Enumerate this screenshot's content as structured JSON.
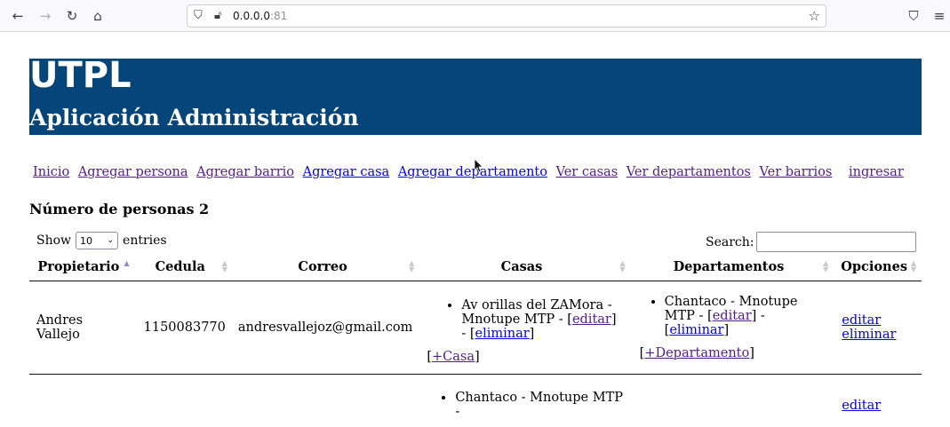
{
  "browser": {
    "url": "0.0.0.0",
    "port": ":81"
  },
  "header": {
    "logo": "UTPL",
    "title": "Aplicación Administración"
  },
  "menu": [
    {
      "label": "Inicio"
    },
    {
      "label": "Agregar persona"
    },
    {
      "label": "Agregar barrio"
    },
    {
      "label": "Agregar casa"
    },
    {
      "label": "Agregar departamento"
    },
    {
      "label": "Ver casas"
    },
    {
      "label": "Ver departamentos"
    },
    {
      "label": "Ver barrios"
    },
    {
      "label": "ingresar"
    }
  ],
  "count_title": "Número de personas 2",
  "table_controls": {
    "show_label": "Show",
    "entries_value": "10",
    "entries_label": "entries",
    "search_label": "Search:"
  },
  "columns": [
    "Propietario",
    "Cedula",
    "Correo",
    "Casas",
    "Departamentos",
    "Opciones"
  ],
  "rows": [
    {
      "propietario": "Andres Vallejo",
      "cedula": "1150083770",
      "correo": "andresvallejoz@gmail.com",
      "casa_text": "Av orillas del ZAMora - Mnotupe MTP - [",
      "casa_edit": "editar",
      "casa_mid": "] - [",
      "casa_delete": "eliminar",
      "casa_end": "]",
      "add_casa_open": "[",
      "add_casa": "+Casa",
      "add_casa_close": "]",
      "depto_text": "Chantaco - Mnotupe MTP - [",
      "depto_edit": "editar",
      "depto_mid": "] - [",
      "depto_delete": "eliminar",
      "depto_end": "]",
      "add_depto_open": "[",
      "add_depto": "+Departamento",
      "add_depto_close": "]",
      "opt_edit": "editar",
      "opt_delete": "eliminar"
    },
    {
      "casa_text": "Chantaco - Mnotupe MTP -",
      "opt_edit": "editar"
    }
  ]
}
